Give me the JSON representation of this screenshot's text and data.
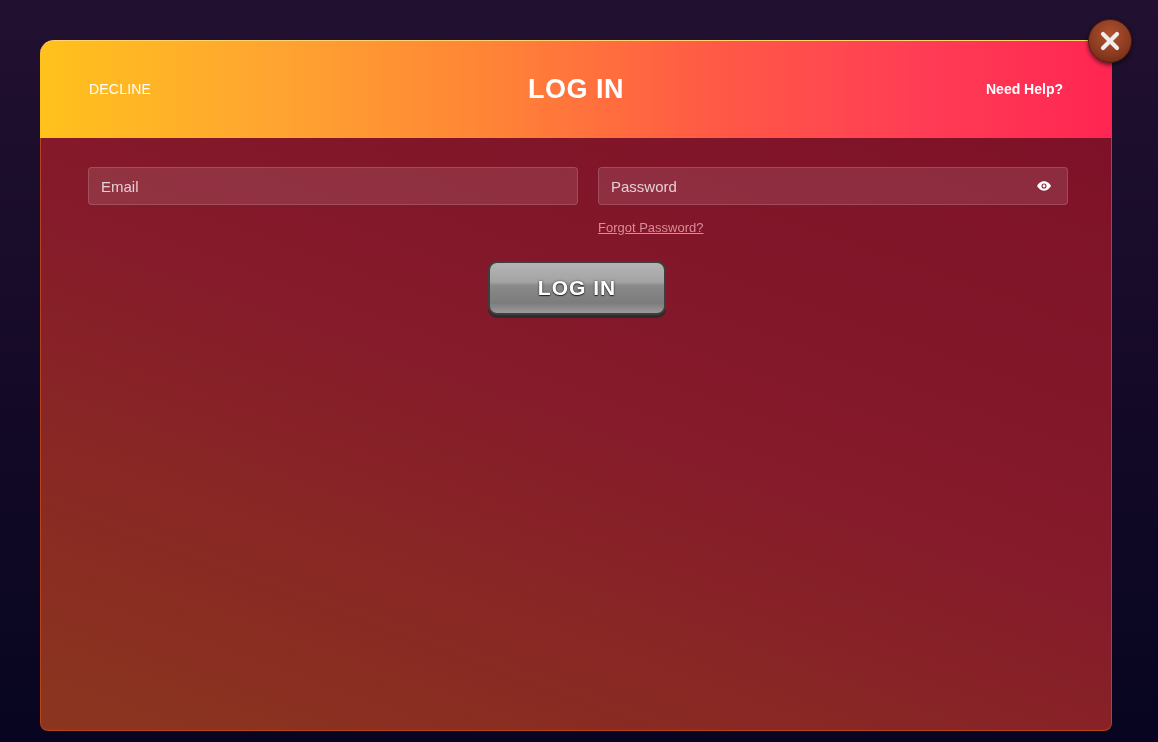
{
  "dialog": {
    "header": {
      "decline": "DECLINE",
      "title": "LOG IN",
      "help": "Need Help?"
    },
    "fields": [
      {
        "kind": "email",
        "placeholder": "Email"
      },
      {
        "kind": "password",
        "placeholder": "Password"
      }
    ],
    "forgot_link": "Forgot Password?",
    "submit": "LOG IN"
  }
}
